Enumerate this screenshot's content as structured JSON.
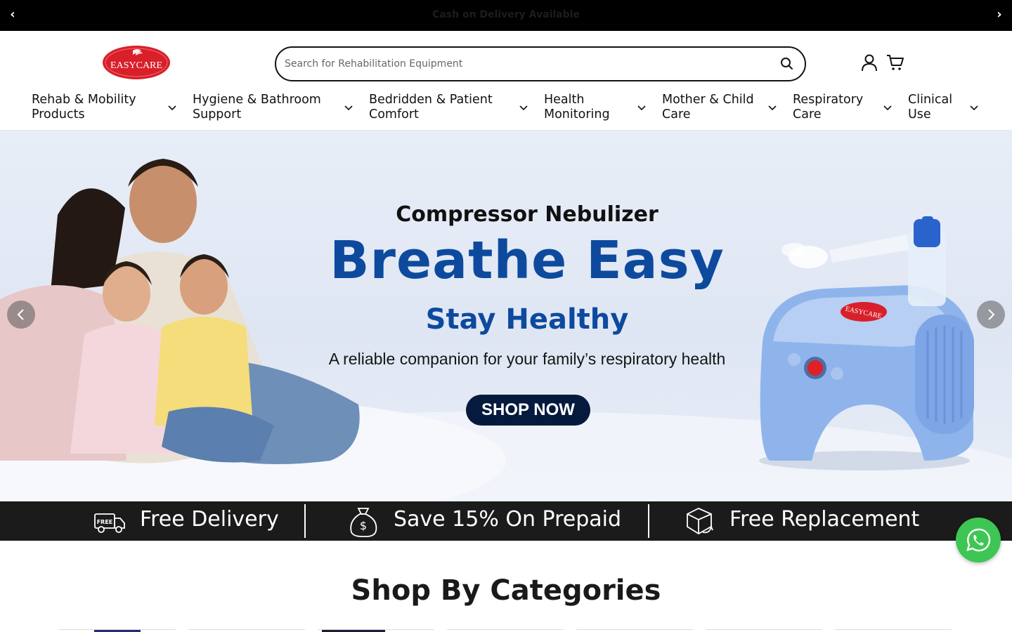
{
  "announcement": {
    "message": "Cash on Delivery Available",
    "prev": "‹",
    "next": "›"
  },
  "header": {
    "logo_text": "EASYCARE",
    "search_placeholder": "Search for Rehabilitation Equipment",
    "icons": [
      "search-icon",
      "account-icon",
      "cart-icon"
    ]
  },
  "nav": {
    "items": [
      {
        "line1": "Rehab & Mobility",
        "line2": "Products"
      },
      {
        "line1": "Hygiene & Bathroom",
        "line2": "Support"
      },
      {
        "line1": "Bedridden & Patient",
        "line2": "Comfort"
      },
      {
        "line1": "Health",
        "line2": "Monitoring"
      },
      {
        "line1": "Mother & Child",
        "line2": "Care"
      },
      {
        "line1": "Respiratory",
        "line2": "Care"
      },
      {
        "line1": "Clinical",
        "line2": "Use"
      }
    ]
  },
  "hero": {
    "subtitle": "Compressor Nebulizer",
    "headline": "Breathe Easy",
    "tagline": "Stay Healthy",
    "description": "A reliable companion for your family’s respiratory health",
    "cta": "SHOP NOW",
    "product_logo": "EASYCARE"
  },
  "benefits": [
    {
      "icon": "delivery-truck-icon",
      "text": "Free Delivery",
      "badge": "FREE"
    },
    {
      "icon": "money-bag-icon",
      "text": "Save 15% On Prepaid"
    },
    {
      "icon": "replacement-box-icon",
      "text": "Free Replacement"
    }
  ],
  "categories": {
    "title": "Shop By Categories"
  },
  "colors": {
    "brand_blue": "#0d4a9e",
    "brand_red": "#d81f2a",
    "cta_navy": "#061a3e",
    "whatsapp_green": "#3ec654",
    "benefits_bg": "#1b1b1b"
  }
}
